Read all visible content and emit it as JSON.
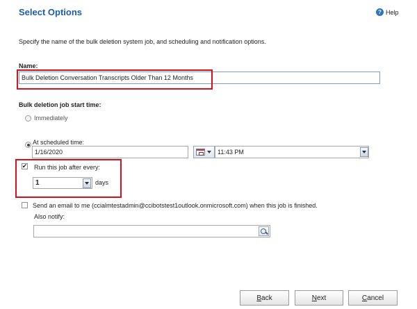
{
  "header": {
    "title": "Select Options",
    "help_label": "Help",
    "help_icon": "?"
  },
  "description": "Specify the name of the bulk deletion system job, and scheduling and notification options.",
  "name_section": {
    "label": "Name:",
    "value": "Bulk Deletion Conversation Transcripts Older Than 12 Months"
  },
  "start_time": {
    "label": "Bulk deletion job start time:",
    "immediately": {
      "label": "Immediately",
      "selected": false,
      "enabled": false
    },
    "scheduled": {
      "label": "At scheduled time:",
      "selected": true,
      "date": "1/16/2020",
      "time": "11:43 PM",
      "calendar_icon": "calendar-icon"
    }
  },
  "recurrence": {
    "label": "Run this job after every:",
    "checked": true,
    "check_mark": "✔",
    "interval": "1",
    "unit": "days"
  },
  "notification": {
    "email_label": "Send an email to me (ccialmtestadmin@ccibotstest1outlook.onmicrosoft.com) when this job is finished.",
    "email_checked": false,
    "also_notify_label": "Also notify:",
    "also_notify_value": "",
    "lookup_icon": "lookup-icon"
  },
  "footer": {
    "back": {
      "mnemonic": "B",
      "rest": "ack"
    },
    "next": {
      "mnemonic": "N",
      "rest": "ext"
    },
    "cancel": {
      "mnemonic": "C",
      "rest": "ancel"
    }
  },
  "colors": {
    "title": "#1a5ea8",
    "highlight_box": "#d6111c",
    "help_icon": "#2a73c9"
  }
}
